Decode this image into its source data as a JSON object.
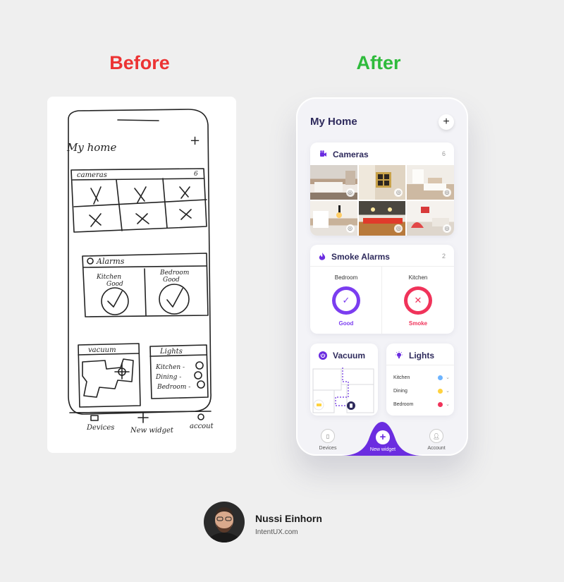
{
  "labels": {
    "before": "Before",
    "after": "After"
  },
  "sketch": {
    "title": "My home",
    "plus": "+",
    "cameras_label": "cameras",
    "cameras_count": "6",
    "alarms_label": "Alarms",
    "alarm_left": [
      "Kitchen",
      "Good"
    ],
    "alarm_right": [
      "Bedroom",
      "Good"
    ],
    "vacuum_label": "vacuum",
    "lights_label": "Lights",
    "lights": [
      "Kitchen -",
      "Dining -",
      "Bedroom -"
    ],
    "nav": [
      "Devices",
      "New widget",
      "accout"
    ]
  },
  "app": {
    "title": "My Home",
    "add": "+",
    "cameras": {
      "title": "Cameras",
      "count": "6"
    },
    "smoke": {
      "title": "Smoke Alarms",
      "count": "2",
      "items": [
        {
          "room": "Bedroom",
          "status": "Good",
          "glyph": "✓",
          "color": "#7b3df0"
        },
        {
          "room": "Kitchen",
          "status": "Smoke",
          "glyph": "✕",
          "color": "#f0335a"
        }
      ]
    },
    "vacuum": {
      "title": "Vacuum"
    },
    "lights": {
      "title": "Lights",
      "items": [
        {
          "room": "Kitchen",
          "color": "#6db4ff"
        },
        {
          "room": "Dining",
          "color": "#ffd23f"
        },
        {
          "room": "Bedroom",
          "color": "#f0335a"
        }
      ]
    },
    "nav": {
      "devices": "Devices",
      "new_widget": "New widget",
      "account": "Account",
      "plus": "+"
    },
    "accent": "#6b2de0"
  },
  "author": {
    "name": "Nussi Einhorn",
    "site": "IntentUX.com"
  }
}
